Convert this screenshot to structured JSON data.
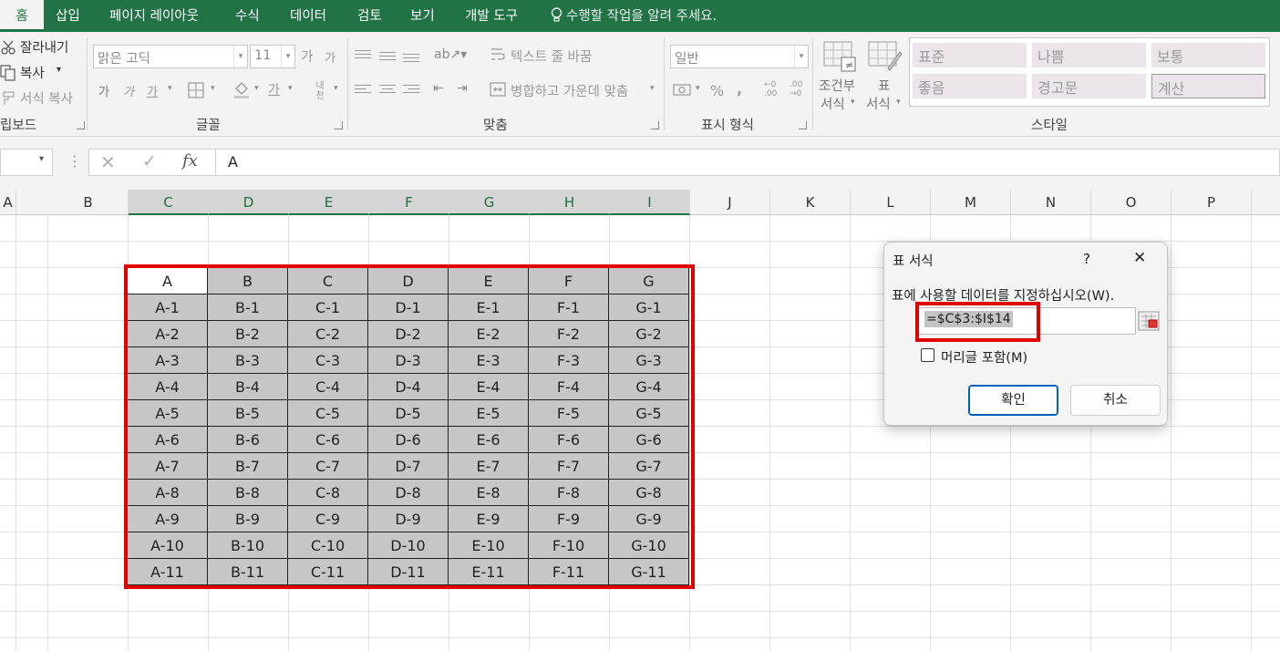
{
  "tabs": {
    "home": "홈",
    "insert": "삽입",
    "page_layout": "페이지 레이아웃",
    "formulas": "수식",
    "data": "데이터",
    "review": "검토",
    "view": "보기",
    "developer": "개발 도구",
    "tell_me": "수행할 작업을 알려 주세요."
  },
  "clipboard": {
    "cut": "잘라내기",
    "copy": "복사",
    "format_painter": "서식 복사",
    "label": "립보드"
  },
  "font": {
    "name": "맑은 고딕",
    "size": "11",
    "grow": "가",
    "shrink": "가",
    "bold": "가",
    "italic": "가",
    "underline": "가",
    "fontcolor": "가",
    "phonetic": "내천",
    "label": "글꼴"
  },
  "alignment": {
    "wrap_text": "텍스트 줄 바꿈",
    "merge_center": "병합하고 가운데 맞춤",
    "label": "맞춤"
  },
  "number": {
    "format": "일반",
    "percent": "%",
    "comma": ",",
    "inc_decimal": "←0\n.00",
    "dec_decimal": ".00\n→0",
    "label": "표시 형식"
  },
  "style_buttons": {
    "conditional_1": "조건부",
    "conditional_2": "서식",
    "table_1": "표",
    "table_2": "서식"
  },
  "styles": {
    "normal": "표준",
    "bad": "나쁨",
    "neutral": "보통",
    "good": "좋음",
    "warning": "경고문",
    "calculation": "계산",
    "label": "스타일"
  },
  "formula_bar": {
    "fx": "fx",
    "value": "A"
  },
  "columns": [
    "A",
    "B",
    "C",
    "D",
    "E",
    "F",
    "G",
    "H",
    "I",
    "J",
    "K",
    "L",
    "M",
    "N",
    "O",
    "P"
  ],
  "table": {
    "headers": [
      "A",
      "B",
      "C",
      "D",
      "E",
      "F",
      "G"
    ],
    "rows": [
      [
        "A-1",
        "B-1",
        "C-1",
        "D-1",
        "E-1",
        "F-1",
        "G-1"
      ],
      [
        "A-2",
        "B-2",
        "C-2",
        "D-2",
        "E-2",
        "F-2",
        "G-2"
      ],
      [
        "A-3",
        "B-3",
        "C-3",
        "D-3",
        "E-3",
        "F-3",
        "G-3"
      ],
      [
        "A-4",
        "B-4",
        "C-4",
        "D-4",
        "E-4",
        "F-4",
        "G-4"
      ],
      [
        "A-5",
        "B-5",
        "C-5",
        "D-5",
        "E-5",
        "F-5",
        "G-5"
      ],
      [
        "A-6",
        "B-6",
        "C-6",
        "D-6",
        "E-6",
        "F-6",
        "G-6"
      ],
      [
        "A-7",
        "B-7",
        "C-7",
        "D-7",
        "E-7",
        "F-7",
        "G-7"
      ],
      [
        "A-8",
        "B-8",
        "C-8",
        "D-8",
        "E-8",
        "F-8",
        "G-8"
      ],
      [
        "A-9",
        "B-9",
        "C-9",
        "D-9",
        "E-9",
        "F-9",
        "G-9"
      ],
      [
        "A-10",
        "B-10",
        "C-10",
        "D-10",
        "E-10",
        "F-10",
        "G-10"
      ],
      [
        "A-11",
        "B-11",
        "C-11",
        "D-11",
        "E-11",
        "F-11",
        "G-11"
      ]
    ]
  },
  "dialog": {
    "title": "표 서식",
    "help": "?",
    "close": "✕",
    "prompt": "표에 사용할 데이터를 지정하십시오(W).",
    "range": "=$C$3:$I$14",
    "header_checkbox": "머리글 포함(M)",
    "ok": "확인",
    "cancel": "취소"
  },
  "colors": {
    "accent": "#217346",
    "highlight": "#e00000",
    "table_fill": "#c6c6c6"
  }
}
